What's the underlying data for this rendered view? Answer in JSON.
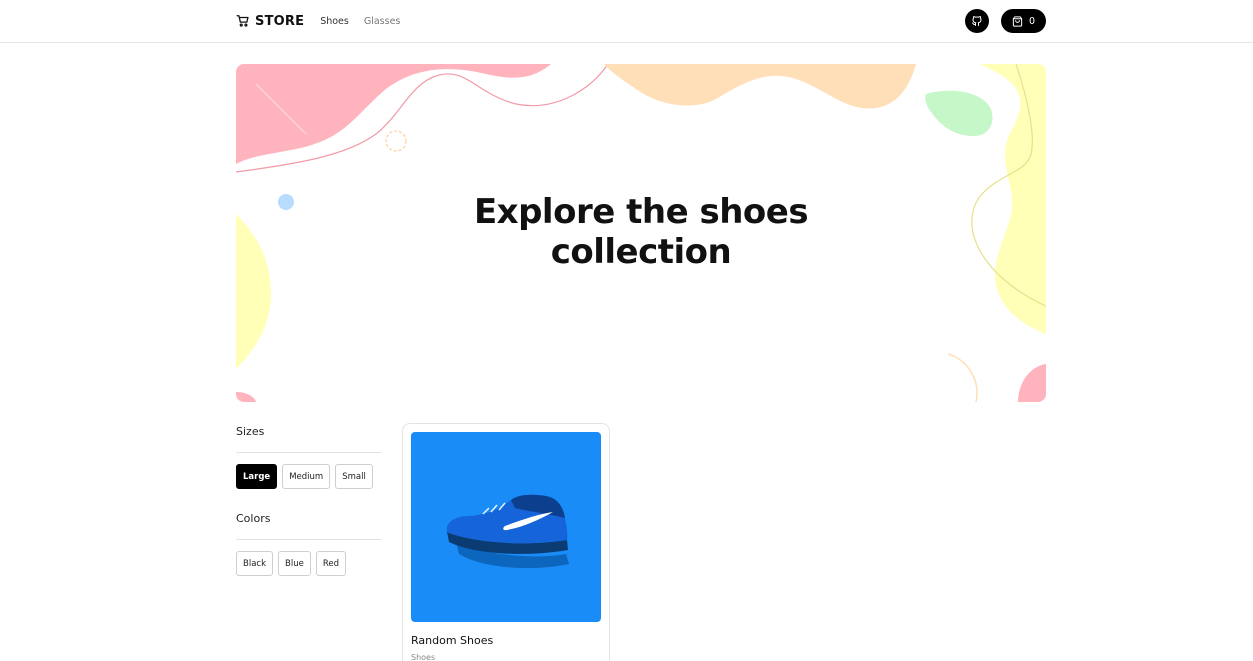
{
  "header": {
    "logo_text": "STORE",
    "nav": [
      {
        "label": "Shoes"
      },
      {
        "label": "Glasses"
      }
    ],
    "cart_count": "0",
    "icons": {
      "logo": "cart-icon",
      "github": "github-icon",
      "cart": "shopping-bag-icon"
    }
  },
  "hero": {
    "title_line1": "Explore the shoes",
    "title_line2": "collection",
    "colors": {
      "pink": "#ffb3bd",
      "peach": "#ffdfb8",
      "yellow": "#ffffb8",
      "green": "#c5f7c8",
      "blue": "#b7dcff"
    }
  },
  "filters": {
    "sizes": {
      "title": "Sizes",
      "options": [
        {
          "label": "Large",
          "selected": true
        },
        {
          "label": "Medium",
          "selected": false
        },
        {
          "label": "Small",
          "selected": false
        }
      ]
    },
    "colors": {
      "title": "Colors",
      "options": [
        {
          "label": "Black",
          "selected": false
        },
        {
          "label": "Blue",
          "selected": false
        },
        {
          "label": "Red",
          "selected": false
        }
      ]
    }
  },
  "products": [
    {
      "name": "Random Shoes",
      "category": "Shoes",
      "image_bg": "#1a8cf7"
    }
  ]
}
